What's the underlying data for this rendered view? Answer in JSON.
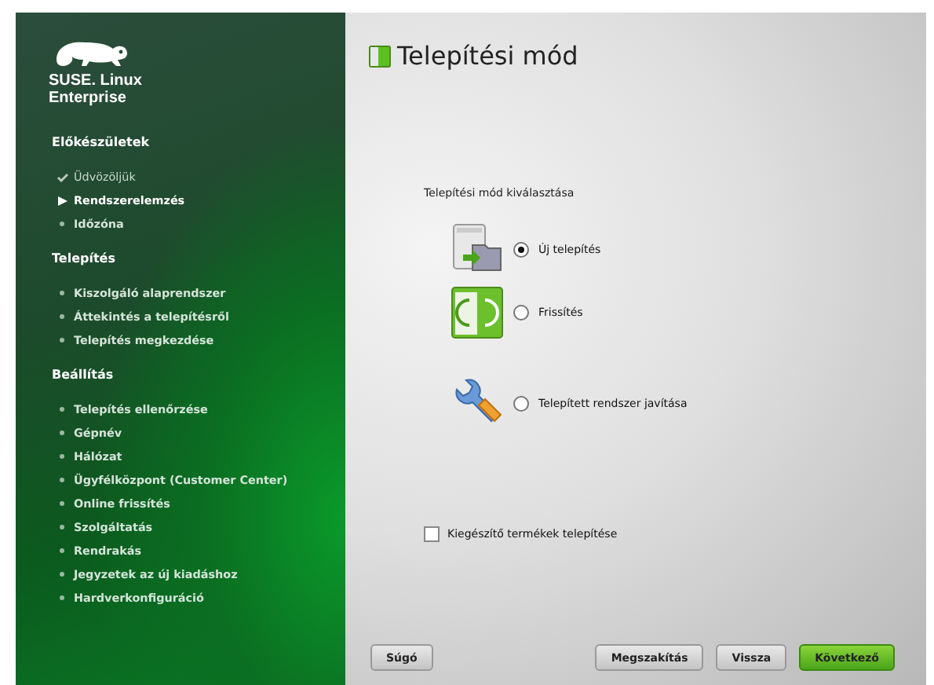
{
  "sidebar": {
    "logo_lines": [
      "SUSE. Linux",
      "Enterprise"
    ],
    "sections": [
      {
        "heading": "Előkészületek",
        "items": [
          {
            "label": "Üdvözöljük",
            "completed": true,
            "current": false
          },
          {
            "label": "Rendszerelemzés",
            "completed": false,
            "current": true
          },
          {
            "label": "Időzóna",
            "completed": false,
            "current": false
          }
        ]
      },
      {
        "heading": "Telepítés",
        "items": [
          {
            "label": "Kiszolgáló alaprendszer",
            "completed": false,
            "current": false
          },
          {
            "label": "Áttekintés a telepítésről",
            "completed": false,
            "current": false
          },
          {
            "label": "Telepítés megkezdése",
            "completed": false,
            "current": false
          }
        ]
      },
      {
        "heading": "Beállítás",
        "items": [
          {
            "label": "Telepítés ellenőrzése",
            "completed": false,
            "current": false
          },
          {
            "label": "Gépnév",
            "completed": false,
            "current": false
          },
          {
            "label": "Hálózat",
            "completed": false,
            "current": false
          },
          {
            "label": "Ügyfélközpont (Customer Center)",
            "completed": false,
            "current": false
          },
          {
            "label": "Online frissítés",
            "completed": false,
            "current": false
          },
          {
            "label": "Szolgáltatás",
            "completed": false,
            "current": false
          },
          {
            "label": "Rendrakás",
            "completed": false,
            "current": false
          },
          {
            "label": "Jegyzetek az új kiadáshoz",
            "completed": false,
            "current": false
          },
          {
            "label": "Hardverkonfiguráció",
            "completed": false,
            "current": false
          }
        ]
      }
    ]
  },
  "page": {
    "title": "Telepítési mód",
    "group_label": "Telepítési mód kiválasztása",
    "options": [
      {
        "kind": "new",
        "label": "Új telepítés",
        "selected": true
      },
      {
        "kind": "update",
        "label": "Frissítés",
        "selected": false
      },
      {
        "kind": "repair",
        "label": "Telepített rendszer javítása",
        "selected": false
      }
    ],
    "addon_checkbox": {
      "label": "Kiegészítő termékek telepítése",
      "checked": false
    }
  },
  "buttons": [
    {
      "kind": "help",
      "label": "Súgó"
    },
    {
      "kind": "normal",
      "label": "Megszakítás"
    },
    {
      "kind": "normal",
      "label": "Vissza"
    },
    {
      "kind": "primary",
      "label": "Következő"
    }
  ]
}
